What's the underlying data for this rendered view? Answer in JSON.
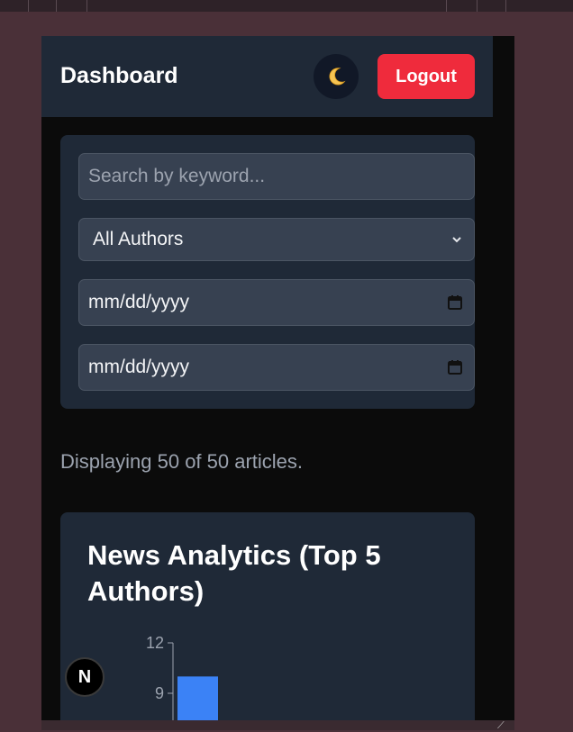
{
  "header": {
    "title": "Dashboard",
    "theme_icon": "moon-icon",
    "logout_label": "Logout",
    "logout_color": "#ef2b3c"
  },
  "filters": {
    "search_placeholder": "Search by keyword...",
    "author_selected": "All Authors",
    "date_from": "mm/dd/yyyy",
    "date_to": "mm/dd/yyyy"
  },
  "results": {
    "display_text": "Displaying 50 of 50 articles."
  },
  "analytics": {
    "title": "News Analytics (Top 5 Authors)"
  },
  "chart_data": {
    "type": "bar",
    "title": "News Analytics (Top 5 Authors)",
    "ytick_labels": [
      "9",
      "12"
    ],
    "ylim": [
      0,
      12
    ],
    "values": [
      10
    ],
    "bar_color": "#3b82f6"
  },
  "overlay": {
    "badge_letter": "N"
  },
  "colors": {
    "panel": "#1f2937",
    "field": "#374151",
    "page_bg": "#0b0b0b",
    "accent": "#3b82f6"
  }
}
